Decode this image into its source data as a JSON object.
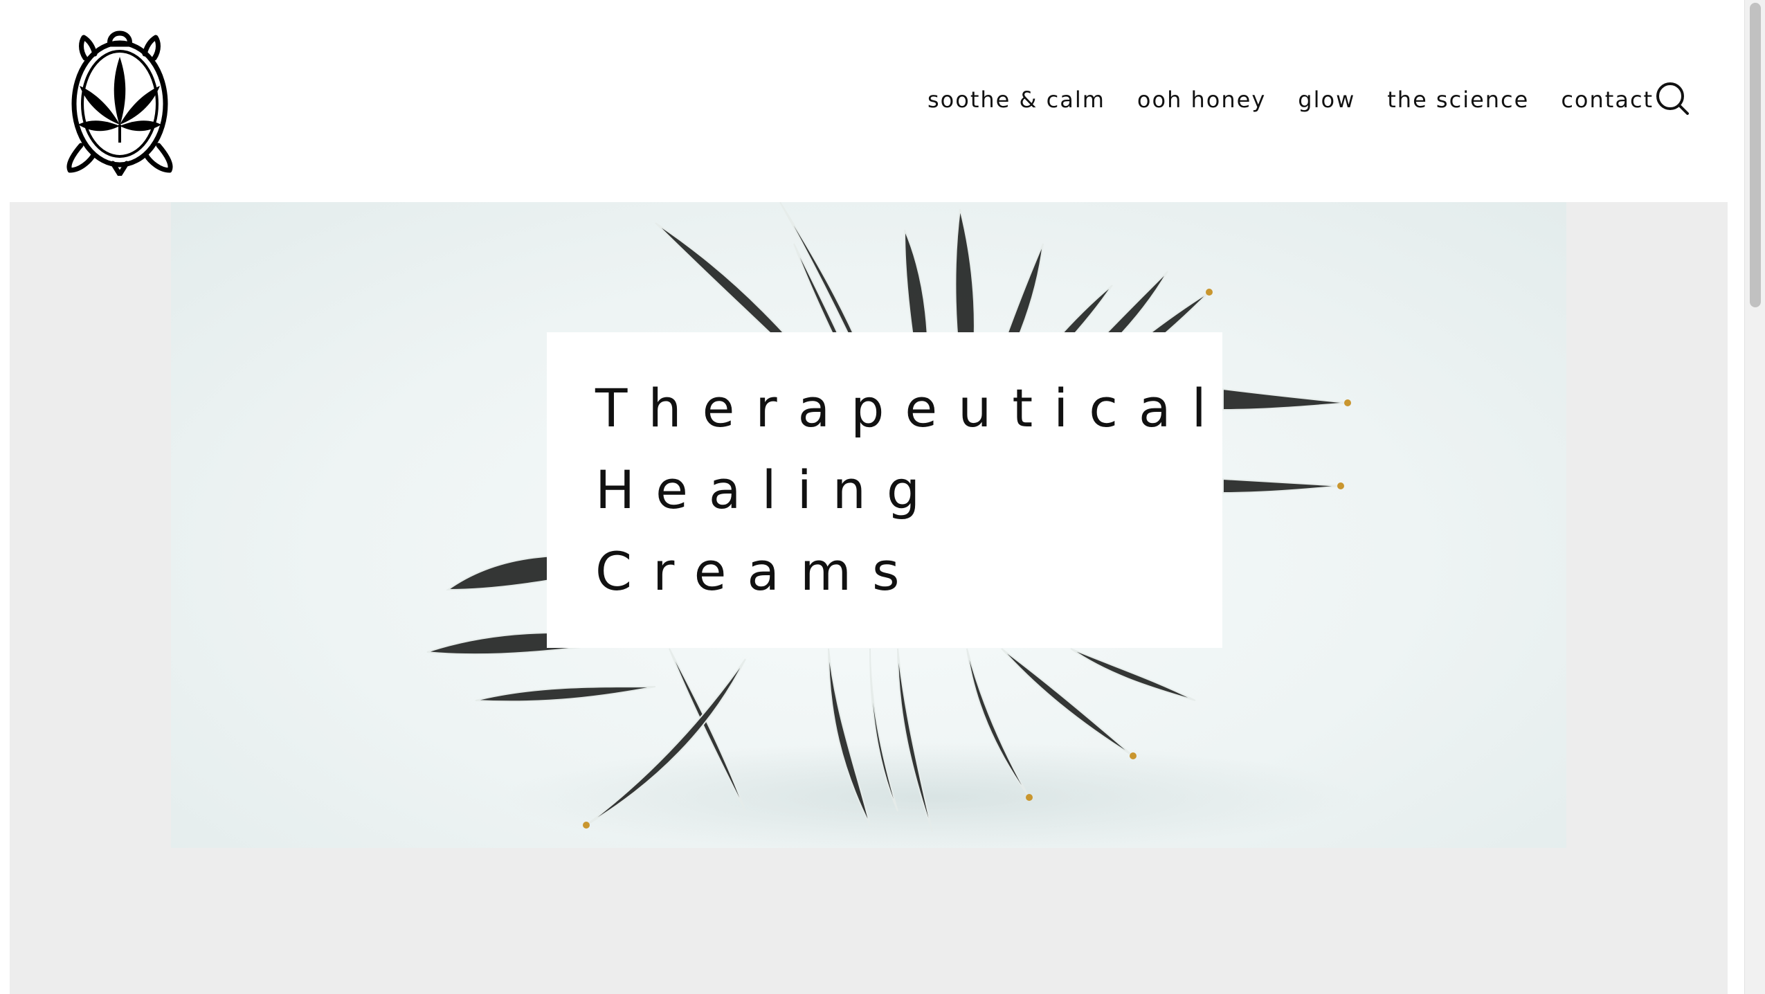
{
  "header": {
    "logo_icon": "turtle-leaf-logo",
    "nav": [
      {
        "label": "soothe & calm"
      },
      {
        "label": "ooh honey"
      },
      {
        "label": "glow"
      },
      {
        "label": "the science"
      },
      {
        "label": "contact"
      }
    ],
    "search_icon": "search-icon"
  },
  "hero": {
    "title_lines": [
      "Therapeutical",
      "Healing",
      "Creams"
    ],
    "image_subject": "cannabis-plant-photo"
  },
  "colors": {
    "text": "#111111",
    "background": "#ffffff",
    "content_bg": "#ededed",
    "leaf_dark": "#2a2c2b",
    "leaf_tip": "#c9962f"
  }
}
